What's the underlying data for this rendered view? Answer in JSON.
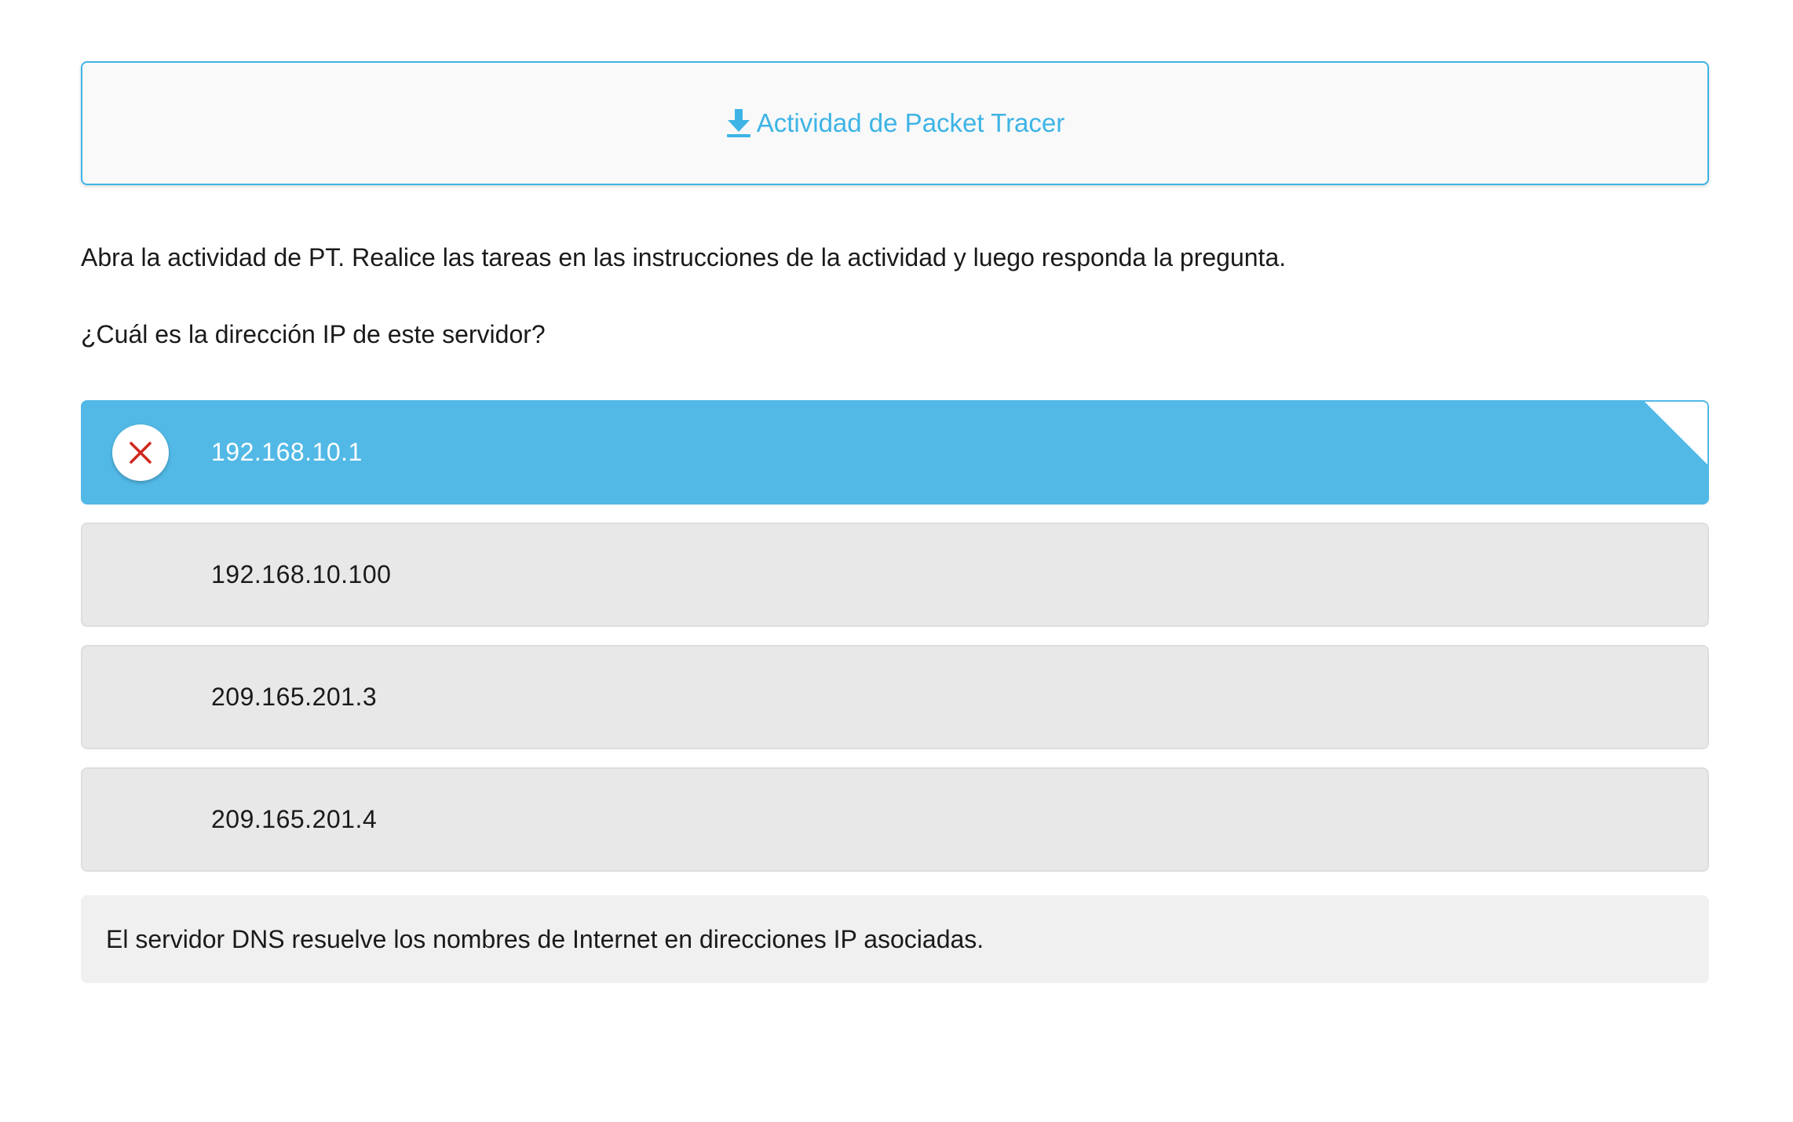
{
  "activity_link": {
    "label": "Actividad de Packet Tracer",
    "icon": "download-icon",
    "color": "#3db4e5"
  },
  "instructions": "Abra la actividad de PT. Realice las tareas en las instrucciones de la actividad y luego responda la pregunta.",
  "question": "¿Cuál es la dirección IP de este servidor?",
  "options": [
    {
      "label": "192.168.10.1",
      "selected": true,
      "status": "incorrect"
    },
    {
      "label": "192.168.10.100",
      "selected": false
    },
    {
      "label": "209.165.201.3",
      "selected": false
    },
    {
      "label": "209.165.201.4",
      "selected": false
    }
  ],
  "feedback": "El servidor DNS resuelve los nombres de Internet en direcciones IP asociadas.",
  "colors": {
    "accent": "#3db4e5",
    "selected_bg": "#52b9e6",
    "incorrect_mark": "#d0271d",
    "option_bg": "#e8e8e8",
    "feedback_bg": "#f0f0f0"
  }
}
